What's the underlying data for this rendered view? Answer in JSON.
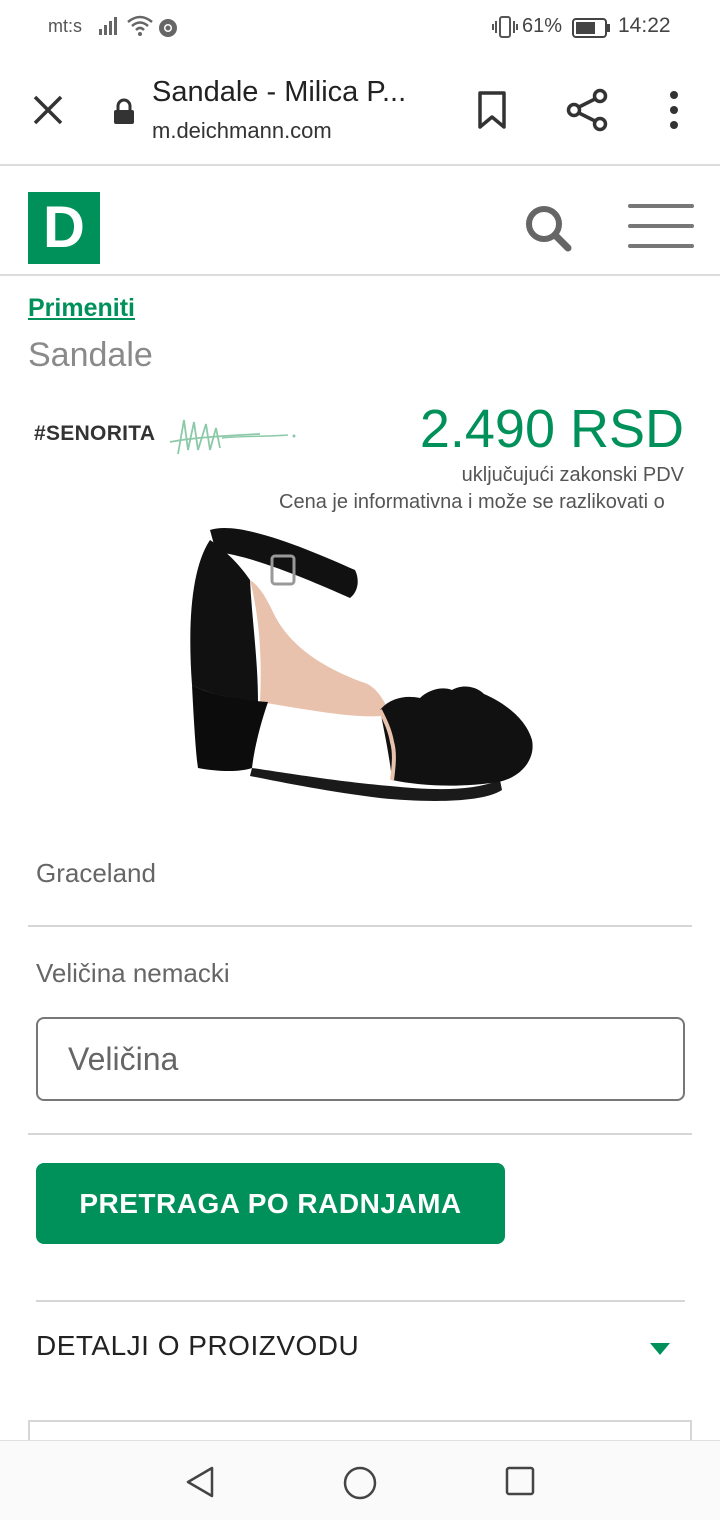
{
  "status_bar": {
    "carrier": "mt:s",
    "battery_percent": "61%",
    "time": "14:22",
    "icons": [
      "signal-icon",
      "wifi-icon",
      "chrome-icon",
      "vibrate-icon",
      "battery-icon"
    ]
  },
  "browser": {
    "page_title": "Sandale - Milica P...",
    "url": "m.deichmann.com",
    "icons": [
      "close-icon",
      "lock-icon",
      "bookmark-icon",
      "share-icon",
      "more-icon"
    ]
  },
  "site_header": {
    "logo_letter": "D",
    "icons": [
      "search-icon",
      "hamburger-menu-icon"
    ]
  },
  "product": {
    "breadcrumb_link": "Primeniti",
    "category": "Sandale",
    "brand_logo_text": "#SENORITA",
    "price": "2.490 RSD",
    "vat_note": "uključujući zakonski PDV",
    "disclaimer": "Cena je informativna i može se razlikovati o",
    "manufacturer": "Graceland",
    "size_label": "Veličina nemacki",
    "size_placeholder": "Veličina",
    "store_search_button": "PRETRAGA PO RADNJAMA",
    "details_accordion": "DETALJI O PROIZVODU"
  },
  "colors": {
    "brand_green": "#00915a",
    "text_gray": "#666666",
    "divider": "#d6d6d6"
  },
  "nav_bar": {
    "icons": [
      "back-icon",
      "home-icon",
      "recents-icon"
    ]
  }
}
